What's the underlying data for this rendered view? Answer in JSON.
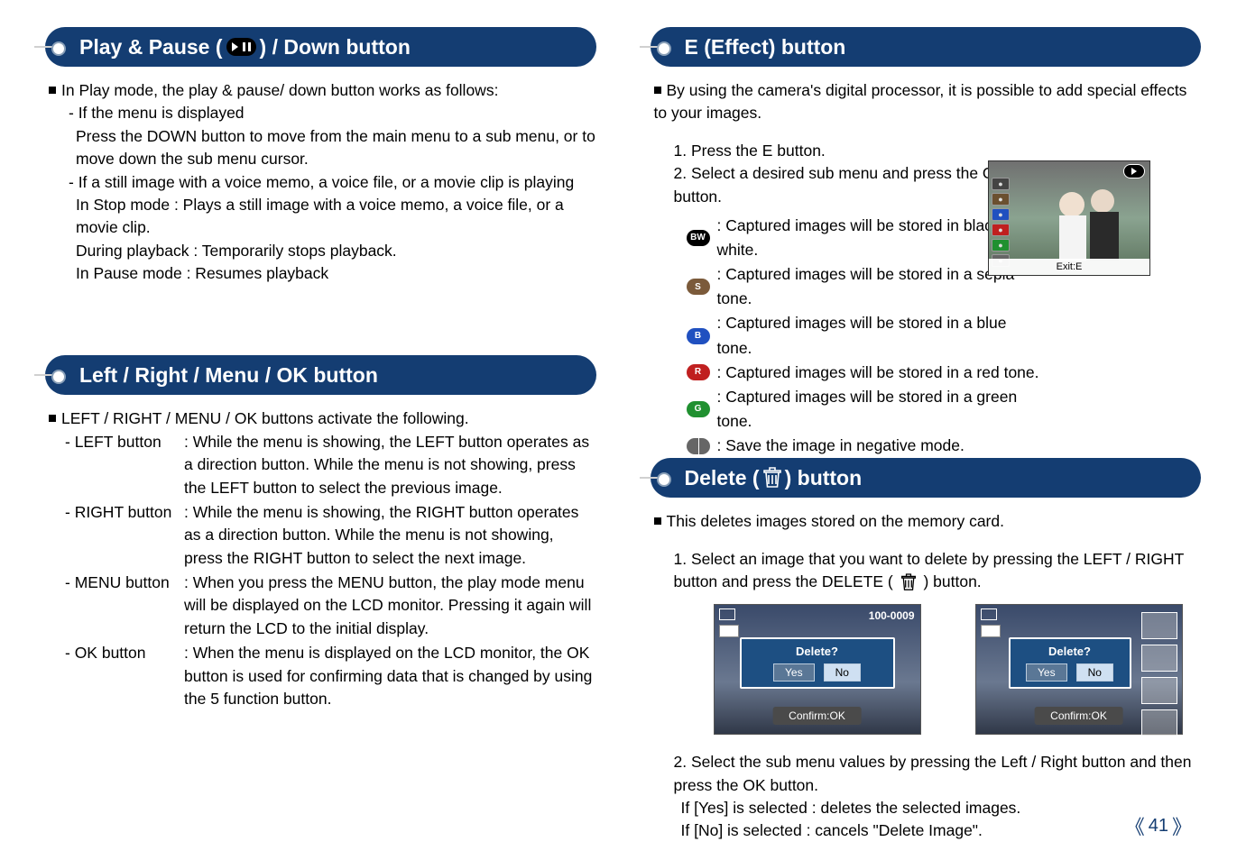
{
  "page_number": "41",
  "left": {
    "section1": {
      "title_prefix": "Play & Pause (",
      "title_suffix": ") / Down button",
      "intro": "In Play mode, the play & pause/ down button works as follows:",
      "sub1_label": "- If the menu is displayed",
      "sub1_body": "Press the DOWN button to move from the main menu to a sub menu, or to move down the sub menu cursor.",
      "sub2_label": "- If a still image with a voice memo, a voice file, or a movie clip is playing",
      "sub2_l1": "In Stop mode : Plays a still image with a voice memo, a voice file, or a movie clip.",
      "sub2_l2": "During playback : Temporarily stops playback.",
      "sub2_l3": "In Pause mode : Resumes playback"
    },
    "section2": {
      "title": "Left / Right / Menu / OK button",
      "intro": "LEFT / RIGHT / MENU / OK buttons activate the following.",
      "defs": [
        {
          "term": "- LEFT button",
          "desc": ": While the menu is showing, the LEFT button operates as a direction button. While the menu is not showing, press the LEFT button to select the previous image."
        },
        {
          "term": "- RIGHT button",
          "desc": ": While the menu is showing, the RIGHT button operates as a direction button. While the menu is not showing, press the RIGHT button to select the next image."
        },
        {
          "term": "- MENU button",
          "desc": ": When you press the MENU button, the play mode menu will be displayed on the LCD monitor. Pressing it again will return the LCD to the initial display."
        },
        {
          "term": "- OK button",
          "desc": ": When the menu is displayed on the LCD monitor, the OK button is used for confirming data that is changed by using the 5 function button."
        }
      ]
    }
  },
  "right": {
    "effect": {
      "title": "E (Effect) button",
      "intro": "By using the camera's digital processor, it is possible to add special effects to your images.",
      "step1": "1. Press the E button.",
      "step2": "2. Select a desired sub menu and press the OK button.",
      "items": [
        ": Captured images will be stored in black and white.",
        ": Captured images will be stored in a sepia tone.",
        ": Captured images will be stored in a blue tone.",
        ": Captured images will be stored in a red tone.",
        ": Captured images will be stored in a green tone.",
        ": Save the image in negative mode."
      ],
      "preview_caption": "Exit:E"
    },
    "delete": {
      "title_prefix": "Delete (",
      "title_suffix": ") button",
      "intro": "This deletes images stored on the memory card.",
      "step1_prefix": "1. Select an image that you want to delete by pressing the LEFT / RIGHT button and press the DELETE (",
      "step1_suffix": ") button.",
      "dialog_file": "100-0009",
      "dialog_title": "Delete?",
      "dialog_yes": "Yes",
      "dialog_no": "No",
      "dialog_confirm": "Confirm:OK",
      "step2": "2. Select the sub menu values by pressing the Left / Right button and then press the OK button.",
      "yes_line": "If [Yes] is selected  : deletes the selected images.",
      "no_line": "If [No] is selected   : cancels \"Delete Image\"."
    }
  }
}
